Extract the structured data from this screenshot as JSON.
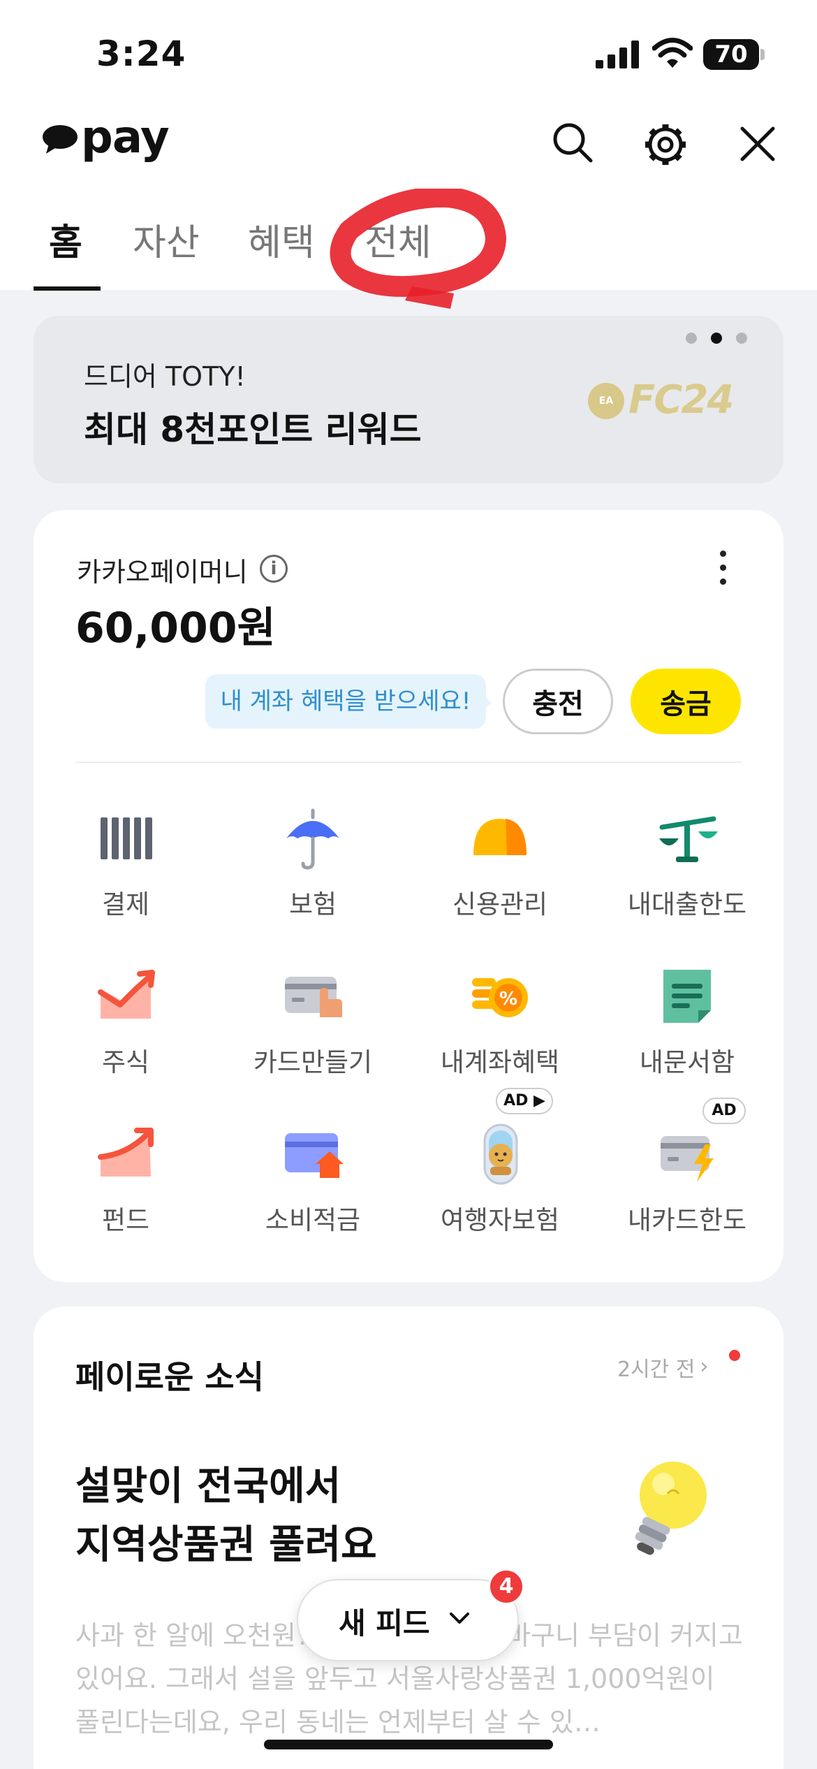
{
  "status_bar": {
    "time": "3:24",
    "battery": "70"
  },
  "header": {
    "logo": "pay"
  },
  "tabs": [
    {
      "label": "홈",
      "active": true
    },
    {
      "label": "자산",
      "active": false
    },
    {
      "label": "혜택",
      "active": false
    },
    {
      "label": "전체",
      "active": false
    }
  ],
  "banner": {
    "subtitle": "드디어 TOTY!",
    "title": "최대 8천포인트 리워드",
    "logo_ea": "EA",
    "logo_fc": "FC24",
    "page_count": 3,
    "active_page": 2
  },
  "money": {
    "label": "카카오페이머니",
    "amount": "60,000원",
    "promo": "내 계좌 혜택을 받으세요!",
    "charge_label": "충전",
    "send_label": "송금"
  },
  "services": [
    {
      "label": "결제",
      "icon": "payment-barcode-icon"
    },
    {
      "label": "보험",
      "icon": "umbrella-icon"
    },
    {
      "label": "신용관리",
      "icon": "credit-gauge-icon"
    },
    {
      "label": "내대출한도",
      "icon": "scale-icon"
    },
    {
      "label": "주식",
      "icon": "stock-chart-icon"
    },
    {
      "label": "카드만들기",
      "icon": "card-hand-icon"
    },
    {
      "label": "내계좌혜택",
      "icon": "coin-percent-icon"
    },
    {
      "label": "내문서함",
      "icon": "document-icon"
    },
    {
      "label": "펀드",
      "icon": "fund-chart-icon"
    },
    {
      "label": "소비적금",
      "icon": "card-house-icon"
    },
    {
      "label": "여행자보험",
      "icon": "travel-character-icon",
      "badge": "AD ▶"
    },
    {
      "label": "내카드한도",
      "icon": "card-lightning-icon",
      "badge": "AD"
    }
  ],
  "news": {
    "title": "페이로운 소식",
    "time": "2시간 전",
    "headline_1": "설맞이 전국에서",
    "headline_2": "지역상품권 풀려요",
    "body": "사과 한 알에 오천원? 올해 명절에도 장바구니 부담이 커지고 있어요. 그래서 설을 앞두고 서울사랑상품권 1,000억원이 풀린다는데요, 우리 동네는 언제부터 살 수 있…"
  },
  "feed_button": {
    "label": "새 피드",
    "badge": "4"
  },
  "colors": {
    "accent_yellow": "#fee500",
    "badge_red": "#ef3b3b",
    "promo_blue": "#2f8fcd",
    "annotation_red": "#e8202a"
  }
}
